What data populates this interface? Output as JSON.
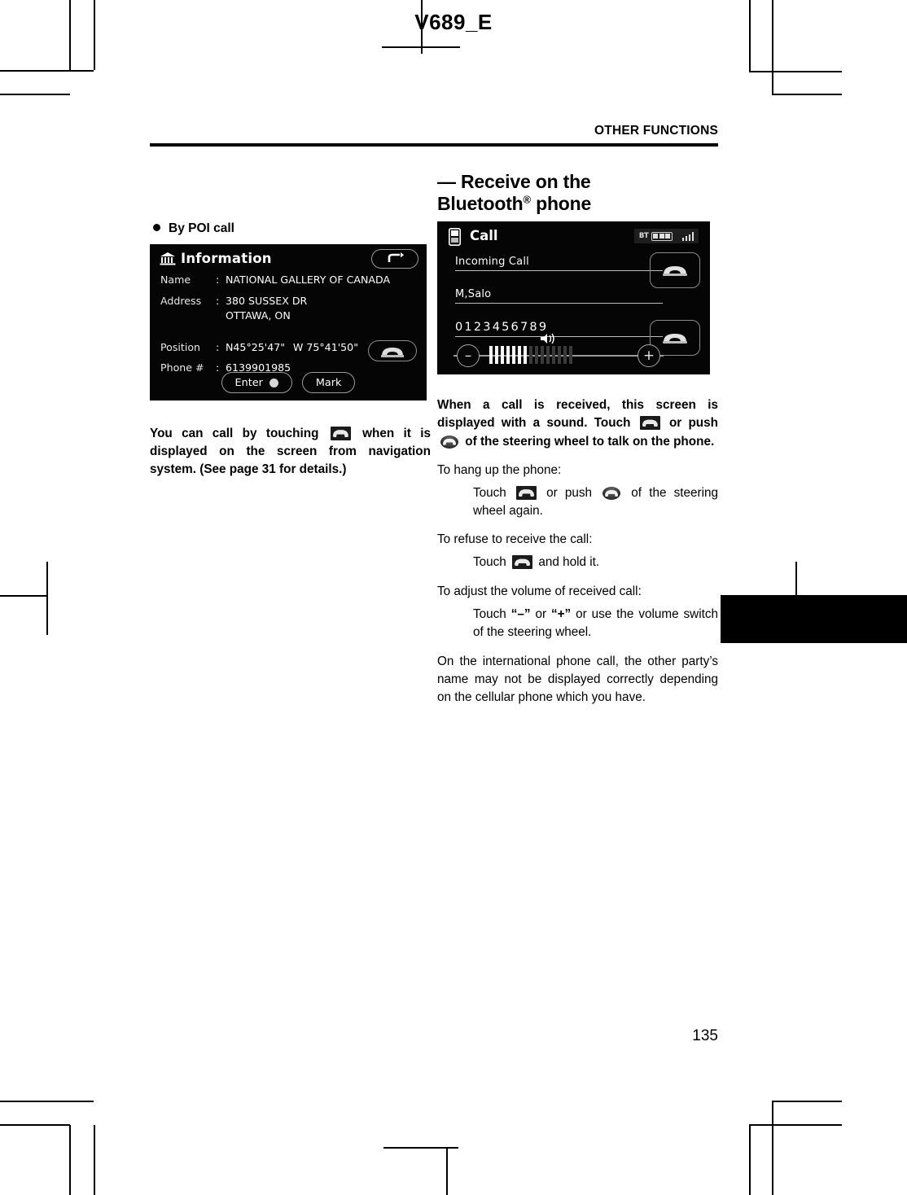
{
  "document": {
    "code": "V689_E",
    "section_header": "OTHER FUNCTIONS",
    "page_number": "135"
  },
  "left_column": {
    "bullet_heading": "By POI call",
    "info_screenshot": {
      "title": "Information",
      "icon": "bank-icon",
      "back_button_icon": "back-arrow-icon",
      "rows": [
        {
          "label": "Name",
          "sep": ":",
          "value": "NATIONAL GALLERY OF CANADA"
        },
        {
          "label": "Address",
          "sep": ":",
          "value": "380 SUSSEX DR"
        },
        {
          "label": "",
          "sep": "",
          "value": "OTTAWA, ON"
        },
        {
          "label": "Position",
          "sep": ":",
          "value": "N45°25'47\"",
          "value2": "W 75°41'50\""
        },
        {
          "label": "Phone #",
          "sep": ":",
          "value": "6139901985"
        }
      ],
      "call_button_icon": "handset-icon",
      "buttons": [
        {
          "label": "Enter",
          "icon": "enter-dot-icon"
        },
        {
          "label": "Mark",
          "icon": ""
        }
      ]
    },
    "paragraph": "You can call by touching ◻ when it is displayed on the screen from navigation system.  (See page 31 for details.)",
    "paragraph_parts": {
      "a": "You can call by touching",
      "b": "when it is displayed on the screen from navigation system.  (See page 31 for details.)"
    }
  },
  "right_column": {
    "section_title_line1": "— Receive on the",
    "section_title_line2_a": "Bluetooth",
    "section_title_sup": "®",
    "section_title_line2_b": " phone",
    "call_screenshot": {
      "title": "Call",
      "icon": "cellphone-icon",
      "status": {
        "bt_label": "BT",
        "battery_bars": 3,
        "signal_bars": 4
      },
      "lines": [
        "Incoming Call",
        "M,Salo",
        "0123456789"
      ],
      "answer_button_icon": "handset-icon",
      "hangup_button_icon": "handset-icon",
      "volume": {
        "minus_label": "–",
        "plus_label": "+",
        "speaker_icon": "speaker-icon",
        "total_bars": 16,
        "active_bars": 7
      }
    },
    "intro_a": "When a call is received, this screen is displayed with a sound.  Touch",
    "intro_b": "or push",
    "intro_c": "of the steering wheel to talk on the phone.",
    "steps": [
      {
        "prompt": "To hang up the phone:",
        "a": "Touch",
        "b": "or push",
        "c": "of the steering wheel again."
      },
      {
        "prompt": "To refuse to receive the call:",
        "a": "Touch",
        "b": "and hold it."
      },
      {
        "prompt": "To adjust the volume of received call:",
        "a": "Touch",
        "q1": "“–”",
        "mid": "or",
        "q2": "“+”",
        "b": "or use the volume switch of the steering wheel."
      }
    ],
    "note": "On the international phone call, the other party’s name may not be displayed correctly depending on the cellular phone which you have."
  }
}
